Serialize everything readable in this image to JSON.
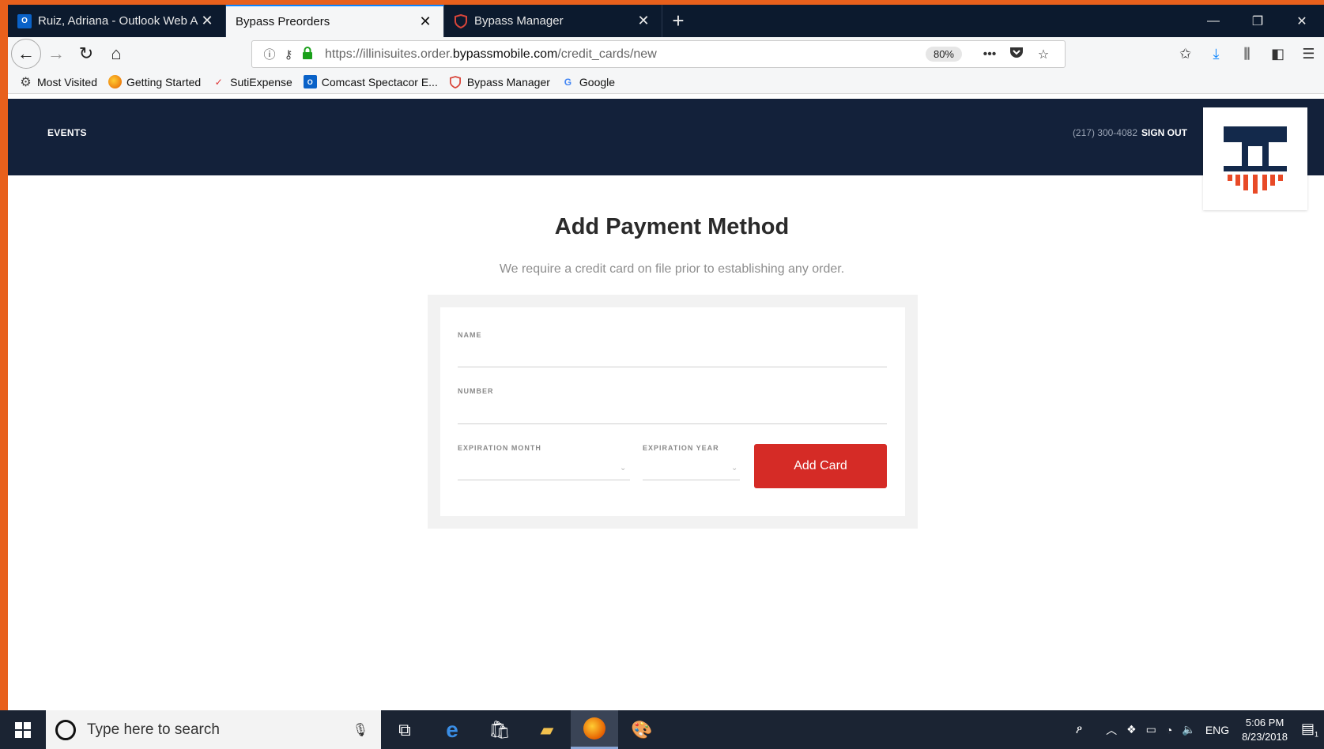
{
  "browser": {
    "tabs": [
      {
        "title": "Ruiz, Adriana - Outlook Web A",
        "icon": "outlook-icon",
        "active": false
      },
      {
        "title": "Bypass Preorders",
        "icon": "",
        "active": true
      },
      {
        "title": "Bypass Manager",
        "icon": "bypass-shield-icon",
        "active": false
      }
    ],
    "new_tab": "+",
    "url_prefix": "https://illinisuites.order.",
    "url_domain": "bypassmobile.com",
    "url_path": "/credit_cards/new",
    "zoom": "80%",
    "bookmarks": [
      "Most Visited",
      "Getting Started",
      "SutiExpense",
      "Comcast Spectacor E...",
      "Bypass Manager",
      "Google"
    ]
  },
  "site": {
    "nav_events": "EVENTS",
    "phone": "(217) 300-4082",
    "sign_out": "SIGN OUT",
    "title": "Add Payment Method",
    "subtitle": "We require a credit card on file prior to establishing any order.",
    "form": {
      "name_label": "NAME",
      "number_label": "NUMBER",
      "exp_month_label": "EXPIRATION MONTH",
      "exp_year_label": "EXPIRATION YEAR",
      "submit_label": "Add Card"
    },
    "colors": {
      "header": "#13213a",
      "button": "#d52b26",
      "logo_orange": "#e84a27"
    }
  },
  "taskbar": {
    "search_placeholder": "Type here to search",
    "language": "ENG",
    "time": "5:06 PM",
    "date": "8/23/2018",
    "notification_count": "1"
  }
}
